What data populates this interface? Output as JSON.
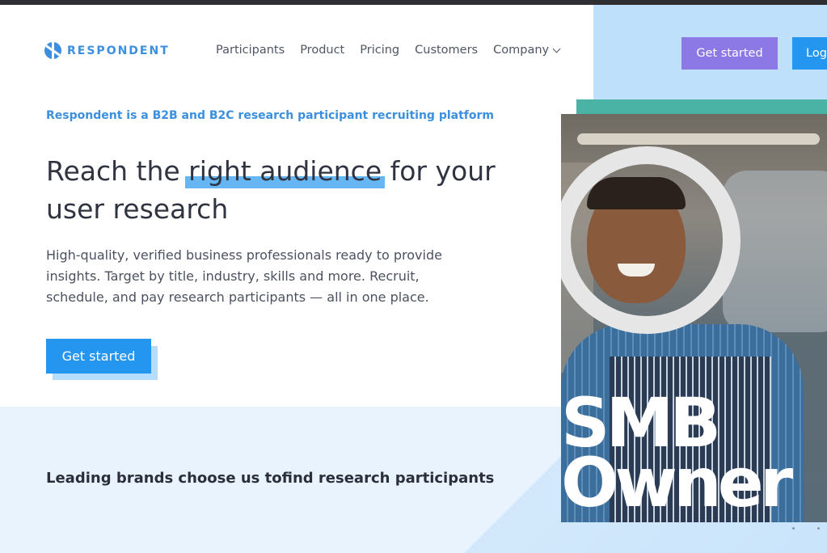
{
  "header": {
    "logo_text": "RESPONDENT",
    "nav": [
      "Participants",
      "Product",
      "Pricing",
      "Customers",
      "Company"
    ],
    "get_started_label": "Get started",
    "login_label": "Log"
  },
  "hero": {
    "eyebrow": "Respondent is a B2B and B2C research participant recruiting platform",
    "headline_before": "Reach the ",
    "headline_highlight": "right audience",
    "headline_after": " for your user research",
    "subtext": "High-quality, verified business professionals ready to provide insights. Target by title, industry, skills and more. Recruit, schedule, and pay research participants — all in one place.",
    "cta_label": "Get started"
  },
  "brands": {
    "text_before": "Leading brands choose us to",
    "text_highlight": "find research participants"
  },
  "photo_card": {
    "line1": "SMB",
    "line2": "Owner"
  },
  "colors": {
    "accent_blue": "#2596f0",
    "purple_button": "#8c79e6",
    "teal": "#4bb3a5",
    "highlight_blue": "#66b6f4",
    "highlight_purple": "#c175c4"
  }
}
